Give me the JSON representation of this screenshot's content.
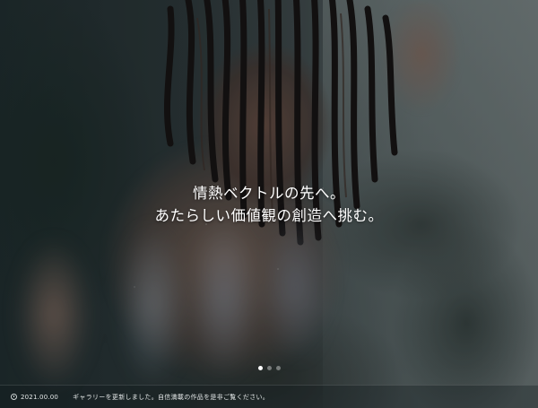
{
  "hero": {
    "headline": {
      "line1": "情熱ベクトルの先へ。",
      "line2": "あたらしい価値観の創造へ挑む。"
    },
    "slider": {
      "slide_count": 3,
      "active_index": 0
    }
  },
  "news": {
    "icon": "clock-icon",
    "date": "2021.00.00",
    "text": "ギャラリーを更新しました。自信満載の作品を是非ご覧ください。"
  },
  "colors": {
    "headline_text": "#ffffff",
    "dot_active": "#ffffff",
    "dot_inactive": "#8d9596",
    "news_text": "#e3e7e7"
  }
}
